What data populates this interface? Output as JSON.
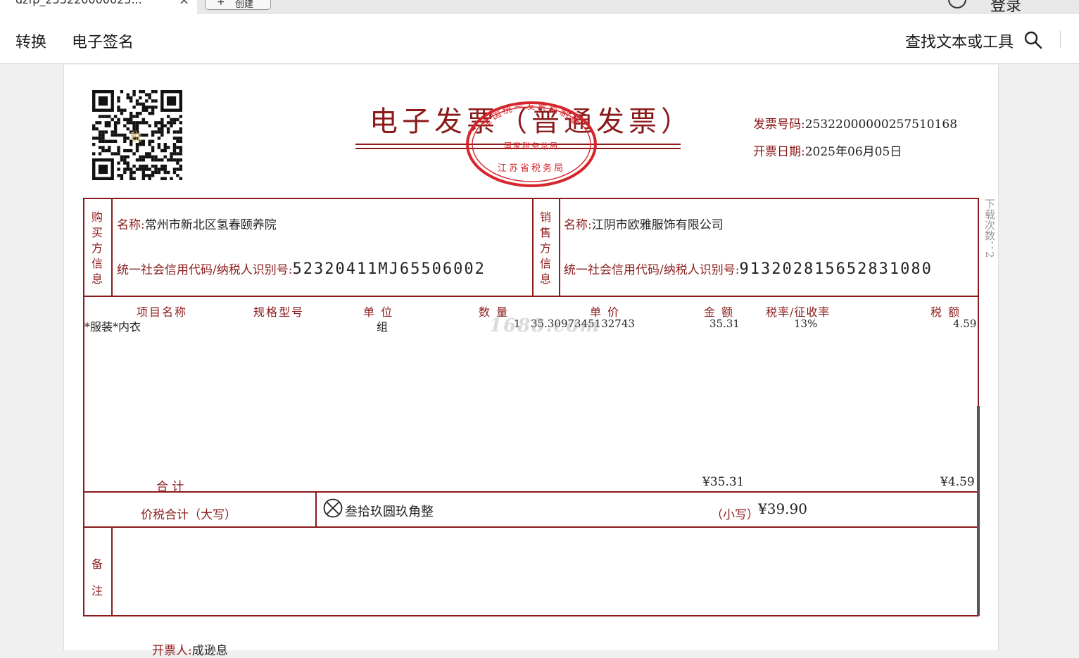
{
  "tab": {
    "title": "dzfp_253220000025...",
    "close": "×"
  },
  "header": {
    "new_button_label": "创建",
    "login_label": "登录"
  },
  "toolbar": {
    "convert_label": "转换",
    "esign_label": "电子签名",
    "search_label": "查找文本或工具"
  },
  "invoice": {
    "title": "电子发票（普通发票）",
    "number_label": "发票号码:",
    "number_value": "25322000000257510168",
    "date_label": "开票日期:",
    "date_value": "2025年06月05日",
    "qr_label": "税",
    "stamp": {
      "top": "全国统一发票监制章",
      "middle": "国家税务总局",
      "bottom": "江苏省税务局"
    },
    "buyer": {
      "section_label": "购买方信息",
      "name_label": "名称:",
      "name_value": "常州市新北区氢春颐养院",
      "taxid_label": "统一社会信用代码/纳税人识别号:",
      "taxid_value": "52320411MJ65506002"
    },
    "seller": {
      "section_label": "销售方信息",
      "name_label": "名称:",
      "name_value": "江阴市欧雅服饰有限公司",
      "taxid_label": "统一社会信用代码/纳税人识别号:",
      "taxid_value": "913202815652831080"
    },
    "columns": [
      "项目名称",
      "规格型号",
      "单  位",
      "数  量",
      "单  价",
      "金  额",
      "税率/征收率",
      "税  额"
    ],
    "items": [
      {
        "name": "*服装*内衣",
        "spec": "",
        "unit": "组",
        "qty": "1",
        "price": "35.3097345132743",
        "amount": "35.31",
        "rate": "13%",
        "tax": "4.59"
      }
    ],
    "watermark": "1688.com",
    "total_label": "合          计",
    "total_amount": "¥35.31",
    "total_tax": "¥4.59",
    "grand_label": "价税合计（大写）",
    "grand_upper": "叁拾玖圆玖角整",
    "grand_lower_label": "（小写）",
    "grand_lower_value": "¥39.90",
    "remark_label": "备注",
    "side_note": "下载次数：2",
    "drawer_label": "开票人:",
    "drawer_value": "成逊息"
  },
  "colors": {
    "invoice_red": "#8b1a1a",
    "stamp_red": "#d6262b"
  }
}
